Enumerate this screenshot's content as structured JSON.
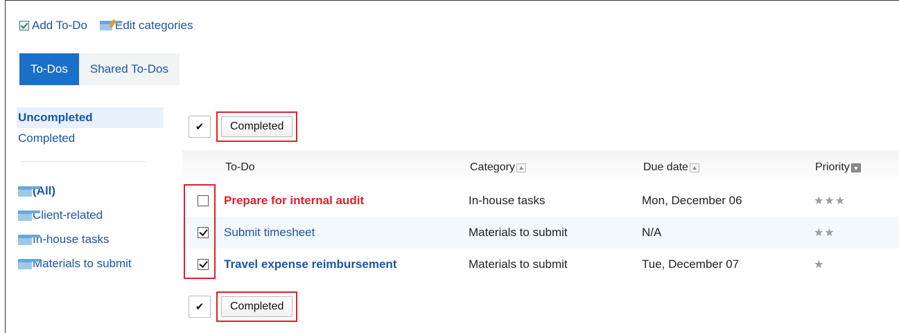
{
  "toolbar": {
    "add_todo": "Add To-Do",
    "edit_categories": "Edit categories"
  },
  "tabs": [
    {
      "label": "To-Dos",
      "active": true
    },
    {
      "label": "Shared To-Dos",
      "active": false
    }
  ],
  "sidebar": {
    "status_links": [
      {
        "label": "Uncompleted",
        "current": true
      },
      {
        "label": "Completed",
        "current": false
      }
    ],
    "categories": [
      {
        "label": "(All)",
        "icon": "folder-icon"
      },
      {
        "label": "Client-related",
        "icon": "folder-icon"
      },
      {
        "label": "In-house tasks",
        "icon": "folder-icon"
      },
      {
        "label": "Materials to submit",
        "icon": "folder-icon"
      }
    ]
  },
  "actions": {
    "check_all_symbol": "✔",
    "completed_button": "Completed"
  },
  "table": {
    "headers": {
      "todo": "To-Do",
      "category": "Category",
      "due_date": "Due date",
      "priority": "Priority"
    },
    "sort": {
      "category": "ascending",
      "due_date": "ascending",
      "priority": "descending"
    },
    "rows": [
      {
        "checked": false,
        "title": "Prepare for internal audit",
        "title_color": "#e0202a",
        "category": "In-house tasks",
        "due": "Mon, December 06",
        "priority_stars": "★★★",
        "priority": 3
      },
      {
        "checked": true,
        "title": "Submit timesheet",
        "title_color": "#1a55a8",
        "category": "Materials to submit",
        "due": "N/A",
        "priority_stars": "★★",
        "priority": 2
      },
      {
        "checked": true,
        "title": "Travel expense reimbursement",
        "title_color": "#1a55a8",
        "category": "Materials to submit",
        "due": "Tue, December 07",
        "priority_stars": "★",
        "priority": 1
      }
    ]
  },
  "colors": {
    "accent": "#1a6fc8",
    "link": "#1a55a8",
    "highlight": "#e0202a",
    "overdue": "#e0202a"
  }
}
